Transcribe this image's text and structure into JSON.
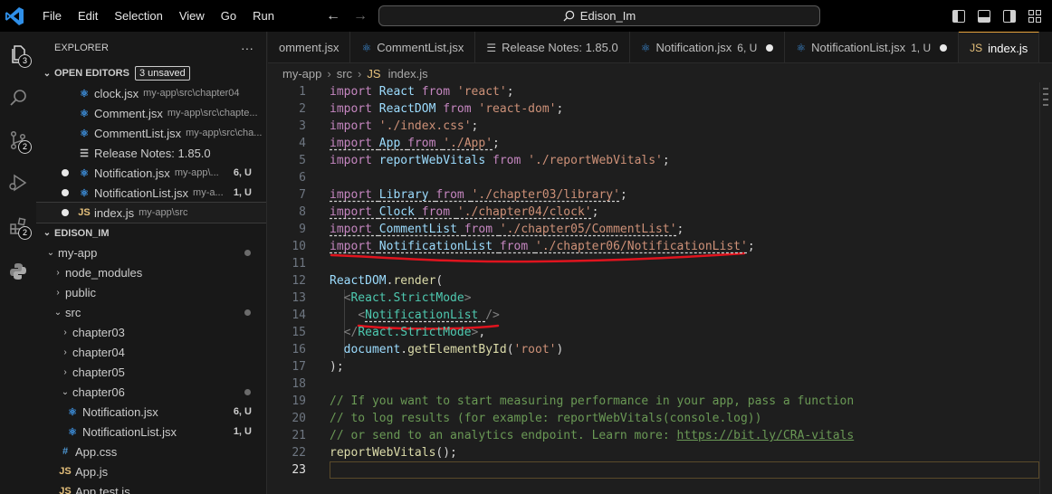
{
  "titlebar": {
    "menu": [
      "File",
      "Edit",
      "Selection",
      "View",
      "Go",
      "Run"
    ],
    "command_center": "Edison_Im"
  },
  "activity": {
    "explorer_badge": "3",
    "scm_badge": "2",
    "extensions_badge": "2"
  },
  "sidebar": {
    "title": "EXPLORER",
    "more": "···",
    "open_editors_label": "OPEN EDITORS",
    "unsaved_badge": "3 unsaved",
    "open_editors": [
      {
        "name": "clock.jsx",
        "path": "my-app\\src\\chapter04",
        "type": "react",
        "dirty": false,
        "status": ""
      },
      {
        "name": "Comment.jsx",
        "path": "my-app\\src\\chapte...",
        "type": "react",
        "dirty": false,
        "status": ""
      },
      {
        "name": "CommentList.jsx",
        "path": "my-app\\src\\cha...",
        "type": "react",
        "dirty": false,
        "status": ""
      },
      {
        "name": "Release Notes: 1.85.0",
        "path": "",
        "type": "notes",
        "dirty": false,
        "status": ""
      },
      {
        "name": "Notification.jsx",
        "path": "my-app\\...",
        "type": "react",
        "dirty": true,
        "status": "6, U"
      },
      {
        "name": "NotificationList.jsx",
        "path": "my-a...",
        "type": "react",
        "dirty": true,
        "status": "1, U"
      },
      {
        "name": "index.js",
        "path": "my-app\\src",
        "type": "js",
        "dirty": true,
        "status": ""
      }
    ],
    "workspace_label": "EDISON_IM",
    "tree": [
      {
        "label": "my-app",
        "indent": 1,
        "chev": "v",
        "kind": "folder",
        "status": "",
        "mdot": true
      },
      {
        "label": "node_modules",
        "indent": 2,
        "chev": ">",
        "kind": "folder",
        "status": "",
        "mdot": false
      },
      {
        "label": "public",
        "indent": 2,
        "chev": ">",
        "kind": "folder",
        "status": "",
        "mdot": false
      },
      {
        "label": "src",
        "indent": 2,
        "chev": "v",
        "kind": "folder",
        "status": "",
        "mdot": true
      },
      {
        "label": "chapter03",
        "indent": 3,
        "chev": ">",
        "kind": "folder",
        "status": "",
        "mdot": false
      },
      {
        "label": "chapter04",
        "indent": 3,
        "chev": ">",
        "kind": "folder",
        "status": "",
        "mdot": false
      },
      {
        "label": "chapter05",
        "indent": 3,
        "chev": ">",
        "kind": "folder",
        "status": "",
        "mdot": false
      },
      {
        "label": "chapter06",
        "indent": 3,
        "chev": "v",
        "kind": "folder",
        "status": "",
        "mdot": true
      },
      {
        "label": "Notification.jsx",
        "indent": 4,
        "chev": "",
        "kind": "react",
        "status": "6, U",
        "mdot": false
      },
      {
        "label": "NotificationList.jsx",
        "indent": 4,
        "chev": "",
        "kind": "react",
        "status": "1, U",
        "mdot": false
      },
      {
        "label": "App.css",
        "indent": 3,
        "chev": "",
        "kind": "css",
        "status": "",
        "mdot": false
      },
      {
        "label": "App.js",
        "indent": 3,
        "chev": "",
        "kind": "js",
        "status": "",
        "mdot": false
      },
      {
        "label": "App.test.js",
        "indent": 3,
        "chev": "",
        "kind": "js",
        "status": "",
        "mdot": false
      }
    ]
  },
  "tabs": [
    {
      "label": "omment.jsx",
      "type": "react",
      "status": "",
      "dirty": false,
      "active": false
    },
    {
      "label": "CommentList.jsx",
      "type": "react",
      "status": "",
      "dirty": false,
      "active": false
    },
    {
      "label": "Release Notes: 1.85.0",
      "type": "notes",
      "status": "",
      "dirty": false,
      "active": false
    },
    {
      "label": "Notification.jsx",
      "type": "react",
      "status": "6, U",
      "dirty": true,
      "active": false
    },
    {
      "label": "NotificationList.jsx",
      "type": "react",
      "status": "1, U",
      "dirty": true,
      "active": false
    },
    {
      "label": "index.js",
      "type": "js",
      "status": "",
      "dirty": false,
      "active": true
    }
  ],
  "breadcrumb": [
    "my-app",
    "src",
    "index.js"
  ],
  "editor": {
    "current_line": 23,
    "lines": [
      [
        [
          "kw",
          "import "
        ],
        [
          "id",
          "React "
        ],
        [
          "kw",
          "from "
        ],
        [
          "str",
          "'react'"
        ],
        [
          "",
          ";"
        ]
      ],
      [
        [
          "kw",
          "import "
        ],
        [
          "id",
          "ReactDOM "
        ],
        [
          "kw",
          "from "
        ],
        [
          "str",
          "'react-dom'"
        ],
        [
          "",
          ";"
        ]
      ],
      [
        [
          "kw",
          "import "
        ],
        [
          "str",
          "'./index.css'"
        ],
        [
          "",
          ";"
        ]
      ],
      [
        [
          "kw sq",
          "import "
        ],
        [
          "id sq",
          "App "
        ],
        [
          "kw sq",
          "from "
        ],
        [
          "str sq",
          "'./App'"
        ],
        [
          "",
          ";"
        ]
      ],
      [
        [
          "kw",
          "import "
        ],
        [
          "id",
          "reportWebVitals "
        ],
        [
          "kw",
          "from "
        ],
        [
          "str",
          "'./reportWebVitals'"
        ],
        [
          "",
          ";"
        ]
      ],
      [],
      [
        [
          "kw sq",
          "import "
        ],
        [
          "id sq",
          "Library "
        ],
        [
          "kw sq",
          "from "
        ],
        [
          "str sq",
          "'./chapter03/library'"
        ],
        [
          "",
          ";"
        ]
      ],
      [
        [
          "kw sq",
          "import "
        ],
        [
          "id sq",
          "Clock "
        ],
        [
          "kw sq",
          "from "
        ],
        [
          "str sq",
          "'./chapter04/clock'"
        ],
        [
          "",
          ";"
        ]
      ],
      [
        [
          "kw sq",
          "import "
        ],
        [
          "id sq",
          "CommentList "
        ],
        [
          "kw sq",
          "from "
        ],
        [
          "str sq",
          "'./chapter05/CommentList'"
        ],
        [
          "",
          ";"
        ]
      ],
      [
        [
          "kw sq",
          "import "
        ],
        [
          "id sq",
          "NotificationList "
        ],
        [
          "kw sq",
          "from "
        ],
        [
          "str sq",
          "'./chapter06/NotificationList'"
        ],
        [
          "",
          ";"
        ]
      ],
      [],
      [
        [
          "id",
          "ReactDOM"
        ],
        [
          "",
          "."
        ],
        [
          "fn",
          "render"
        ],
        [
          "",
          "("
        ]
      ],
      [
        [
          "",
          "  "
        ],
        [
          "punc",
          "<"
        ],
        [
          "tag",
          "React.StrictMode"
        ],
        [
          "punc",
          ">"
        ]
      ],
      [
        [
          "",
          "    "
        ],
        [
          "punc",
          "<"
        ],
        [
          "tag sq",
          "NotificationList "
        ],
        [
          "punc",
          "/>"
        ]
      ],
      [
        [
          "",
          "  "
        ],
        [
          "punc",
          "</"
        ],
        [
          "tag",
          "React.StrictMode"
        ],
        [
          "punc",
          ">"
        ],
        [
          "",
          ","
        ]
      ],
      [
        [
          "",
          "  "
        ],
        [
          "id",
          "document"
        ],
        [
          "",
          "."
        ],
        [
          "fn",
          "getElementById"
        ],
        [
          "",
          "("
        ],
        [
          "str",
          "'root'"
        ],
        [
          "",
          ")"
        ]
      ],
      [
        [
          "",
          ");"
        ]
      ],
      [],
      [
        [
          "cm",
          "// If you want to start measuring performance in your app, pass a function"
        ]
      ],
      [
        [
          "cm",
          "// to log results (for example: reportWebVitals(console.log))"
        ]
      ],
      [
        [
          "cm",
          "// or send to an analytics endpoint. Learn more: "
        ],
        [
          "link",
          "https://bit.ly/CRA-vitals"
        ]
      ],
      [
        [
          "fn",
          "reportWebVitals"
        ],
        [
          "",
          "();"
        ]
      ],
      []
    ]
  },
  "colors": {
    "accent_tab": "#e8a33d",
    "annotation_red": "#e0141e"
  }
}
